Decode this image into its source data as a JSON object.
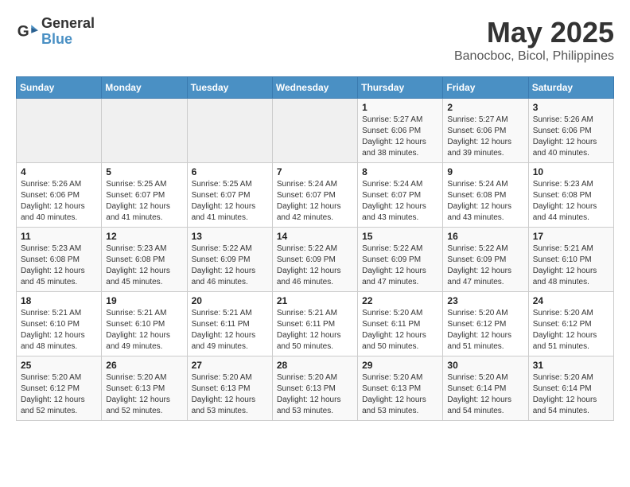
{
  "logo": {
    "line1": "General",
    "line2": "Blue"
  },
  "title": "May 2025",
  "subtitle": "Banocboc, Bicol, Philippines",
  "headers": [
    "Sunday",
    "Monday",
    "Tuesday",
    "Wednesday",
    "Thursday",
    "Friday",
    "Saturday"
  ],
  "weeks": [
    [
      {
        "day": "",
        "info": ""
      },
      {
        "day": "",
        "info": ""
      },
      {
        "day": "",
        "info": ""
      },
      {
        "day": "",
        "info": ""
      },
      {
        "day": "1",
        "info": "Sunrise: 5:27 AM\nSunset: 6:06 PM\nDaylight: 12 hours\nand 38 minutes."
      },
      {
        "day": "2",
        "info": "Sunrise: 5:27 AM\nSunset: 6:06 PM\nDaylight: 12 hours\nand 39 minutes."
      },
      {
        "day": "3",
        "info": "Sunrise: 5:26 AM\nSunset: 6:06 PM\nDaylight: 12 hours\nand 40 minutes."
      }
    ],
    [
      {
        "day": "4",
        "info": "Sunrise: 5:26 AM\nSunset: 6:06 PM\nDaylight: 12 hours\nand 40 minutes."
      },
      {
        "day": "5",
        "info": "Sunrise: 5:25 AM\nSunset: 6:07 PM\nDaylight: 12 hours\nand 41 minutes."
      },
      {
        "day": "6",
        "info": "Sunrise: 5:25 AM\nSunset: 6:07 PM\nDaylight: 12 hours\nand 41 minutes."
      },
      {
        "day": "7",
        "info": "Sunrise: 5:24 AM\nSunset: 6:07 PM\nDaylight: 12 hours\nand 42 minutes."
      },
      {
        "day": "8",
        "info": "Sunrise: 5:24 AM\nSunset: 6:07 PM\nDaylight: 12 hours\nand 43 minutes."
      },
      {
        "day": "9",
        "info": "Sunrise: 5:24 AM\nSunset: 6:08 PM\nDaylight: 12 hours\nand 43 minutes."
      },
      {
        "day": "10",
        "info": "Sunrise: 5:23 AM\nSunset: 6:08 PM\nDaylight: 12 hours\nand 44 minutes."
      }
    ],
    [
      {
        "day": "11",
        "info": "Sunrise: 5:23 AM\nSunset: 6:08 PM\nDaylight: 12 hours\nand 45 minutes."
      },
      {
        "day": "12",
        "info": "Sunrise: 5:23 AM\nSunset: 6:08 PM\nDaylight: 12 hours\nand 45 minutes."
      },
      {
        "day": "13",
        "info": "Sunrise: 5:22 AM\nSunset: 6:09 PM\nDaylight: 12 hours\nand 46 minutes."
      },
      {
        "day": "14",
        "info": "Sunrise: 5:22 AM\nSunset: 6:09 PM\nDaylight: 12 hours\nand 46 minutes."
      },
      {
        "day": "15",
        "info": "Sunrise: 5:22 AM\nSunset: 6:09 PM\nDaylight: 12 hours\nand 47 minutes."
      },
      {
        "day": "16",
        "info": "Sunrise: 5:22 AM\nSunset: 6:09 PM\nDaylight: 12 hours\nand 47 minutes."
      },
      {
        "day": "17",
        "info": "Sunrise: 5:21 AM\nSunset: 6:10 PM\nDaylight: 12 hours\nand 48 minutes."
      }
    ],
    [
      {
        "day": "18",
        "info": "Sunrise: 5:21 AM\nSunset: 6:10 PM\nDaylight: 12 hours\nand 48 minutes."
      },
      {
        "day": "19",
        "info": "Sunrise: 5:21 AM\nSunset: 6:10 PM\nDaylight: 12 hours\nand 49 minutes."
      },
      {
        "day": "20",
        "info": "Sunrise: 5:21 AM\nSunset: 6:11 PM\nDaylight: 12 hours\nand 49 minutes."
      },
      {
        "day": "21",
        "info": "Sunrise: 5:21 AM\nSunset: 6:11 PM\nDaylight: 12 hours\nand 50 minutes."
      },
      {
        "day": "22",
        "info": "Sunrise: 5:20 AM\nSunset: 6:11 PM\nDaylight: 12 hours\nand 50 minutes."
      },
      {
        "day": "23",
        "info": "Sunrise: 5:20 AM\nSunset: 6:12 PM\nDaylight: 12 hours\nand 51 minutes."
      },
      {
        "day": "24",
        "info": "Sunrise: 5:20 AM\nSunset: 6:12 PM\nDaylight: 12 hours\nand 51 minutes."
      }
    ],
    [
      {
        "day": "25",
        "info": "Sunrise: 5:20 AM\nSunset: 6:12 PM\nDaylight: 12 hours\nand 52 minutes."
      },
      {
        "day": "26",
        "info": "Sunrise: 5:20 AM\nSunset: 6:13 PM\nDaylight: 12 hours\nand 52 minutes."
      },
      {
        "day": "27",
        "info": "Sunrise: 5:20 AM\nSunset: 6:13 PM\nDaylight: 12 hours\nand 53 minutes."
      },
      {
        "day": "28",
        "info": "Sunrise: 5:20 AM\nSunset: 6:13 PM\nDaylight: 12 hours\nand 53 minutes."
      },
      {
        "day": "29",
        "info": "Sunrise: 5:20 AM\nSunset: 6:13 PM\nDaylight: 12 hours\nand 53 minutes."
      },
      {
        "day": "30",
        "info": "Sunrise: 5:20 AM\nSunset: 6:14 PM\nDaylight: 12 hours\nand 54 minutes."
      },
      {
        "day": "31",
        "info": "Sunrise: 5:20 AM\nSunset: 6:14 PM\nDaylight: 12 hours\nand 54 minutes."
      }
    ]
  ]
}
